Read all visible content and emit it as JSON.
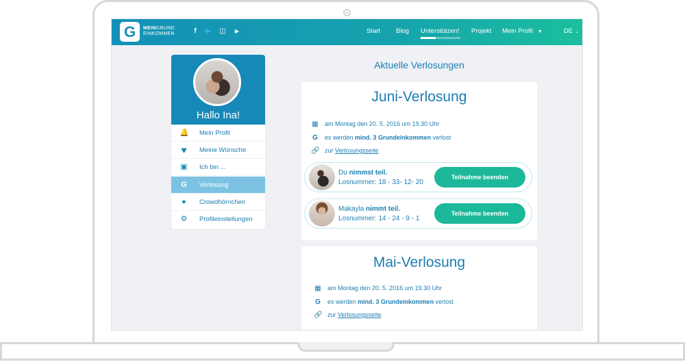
{
  "header": {
    "logo_letter": "G",
    "logo_line1_bold": "MEIN",
    "logo_line1_rest": "GRUND",
    "logo_line2": "EINKOMMEN",
    "social": [
      {
        "icon": "facebook-icon",
        "glyph": "f"
      },
      {
        "icon": "twitter-icon",
        "glyph": "🐦"
      },
      {
        "icon": "instagram-icon",
        "glyph": "◫"
      },
      {
        "icon": "youtube-icon",
        "glyph": "▶"
      }
    ],
    "nav": {
      "start": "Start",
      "blog": "Blog",
      "support": "Unterstützen!",
      "project": "Projekt",
      "profile": "Mein Profil",
      "language": "DE"
    }
  },
  "sidebar": {
    "greeting": "Hallo Ina!",
    "items": [
      {
        "label": "Mein Profil",
        "icon": "bell-icon",
        "glyph": "🔔"
      },
      {
        "label": "Meine Wünsche",
        "icon": "heart-icon",
        "glyph": "♥"
      },
      {
        "label": "Ich bin ...",
        "icon": "id-badge-icon",
        "glyph": "▣"
      },
      {
        "label": "Verlosung",
        "icon": "logo-icon",
        "glyph": "G"
      },
      {
        "label": "Crowdhörnchen",
        "icon": "acorn-icon",
        "glyph": "●"
      },
      {
        "label": "Profileinstellungen",
        "icon": "gears-icon",
        "glyph": "⚙"
      }
    ],
    "active_index": 3
  },
  "main": {
    "title": "Aktuelle Verlosungen",
    "cards": [
      {
        "title": "Juni-Verlosung",
        "date": "am Montag den 20. 5. 2016 um 19.30 Uhr",
        "raffle_prefix": "es werden",
        "raffle_bold": "mind. 3 Grundeinkommen",
        "raffle_suffix": "verlost",
        "link_prefix": "zur",
        "link_text": "Verlosungsseite",
        "entries": [
          {
            "name": "Du",
            "status": "nimmst teil.",
            "number_label": "Losnummer:",
            "numbers": "18 - 33- 12- 20",
            "button": "Teilnahme beenden"
          },
          {
            "name": "Makayla",
            "status": "nimmt teil.",
            "number_label": "Losnummer:",
            "numbers": "14 - 24 - 9 - 1",
            "button": "Teilnahme beenden"
          }
        ]
      },
      {
        "title": "Mai-Verlosung",
        "date": "am Montag den 20. 5. 2016 um 19.30 Uhr",
        "raffle_prefix": "es werden",
        "raffle_bold": "mind. 3 Grundeinkommen",
        "raffle_suffix": "verlost",
        "link_prefix": "zur",
        "link_text": "Verlosungsseite"
      }
    ]
  },
  "colors": {
    "primary": "#1b7db0",
    "header_start": "#1490b8",
    "header_end": "#1bbf9e",
    "button": "#1cb89a",
    "active_menu": "#7dc2e3"
  }
}
